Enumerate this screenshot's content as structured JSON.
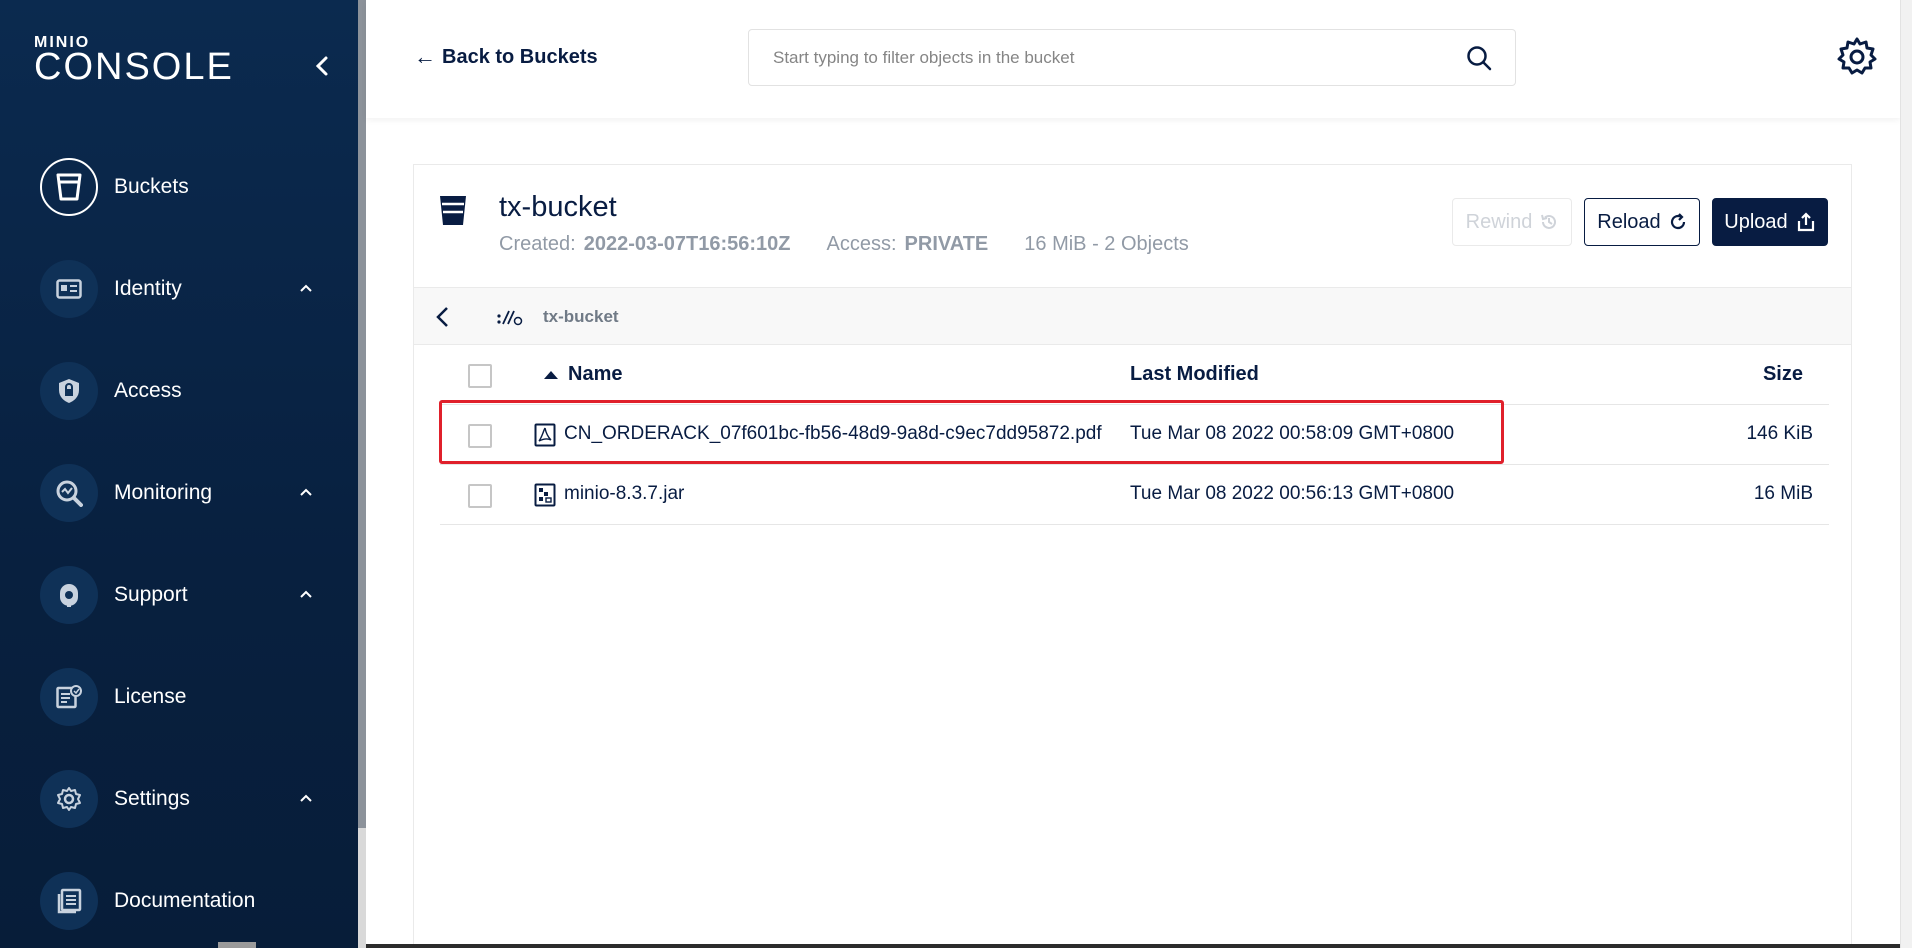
{
  "sidebar": {
    "logo_small": "MINIO",
    "logo_big": "CONSOLE",
    "items": [
      {
        "label": "Buckets",
        "icon": "bucket-icon",
        "active": true,
        "expandable": false
      },
      {
        "label": "Identity",
        "icon": "id-card-icon",
        "active": false,
        "expandable": true
      },
      {
        "label": "Access",
        "icon": "lock-shield-icon",
        "active": false,
        "expandable": false
      },
      {
        "label": "Monitoring",
        "icon": "monitoring-search-icon",
        "active": false,
        "expandable": true
      },
      {
        "label": "Support",
        "icon": "support-icon",
        "active": false,
        "expandable": true
      },
      {
        "label": "License",
        "icon": "license-icon",
        "active": false,
        "expandable": false
      },
      {
        "label": "Settings",
        "icon": "gear-icon",
        "active": false,
        "expandable": true
      },
      {
        "label": "Documentation",
        "icon": "documentation-icon",
        "active": false,
        "expandable": false
      }
    ]
  },
  "header": {
    "back_label": "Back to Buckets",
    "search_placeholder": "Start typing to filter objects in the bucket"
  },
  "bucket": {
    "name": "tx-bucket",
    "created_label": "Created:",
    "created_value": "2022-03-07T16:56:10Z",
    "access_label": "Access:",
    "access_value": "PRIVATE",
    "summary": "16 MiB - 2 Objects"
  },
  "toolbar": {
    "rewind_label": "Rewind",
    "reload_label": "Reload",
    "upload_label": "Upload"
  },
  "breadcrumb": {
    "current": "tx-bucket"
  },
  "table": {
    "columns": {
      "name": "Name",
      "last_modified": "Last Modified",
      "size": "Size"
    },
    "rows": [
      {
        "name": "CN_ORDERACK_07f601bc-fb56-48d9-9a8d-c9ec7dd95872.pdf",
        "last_modified": "Tue Mar 08 2022 00:58:09 GMT+0800",
        "size": "146 KiB",
        "icon": "pdf-file-icon",
        "highlighted": true
      },
      {
        "name": "minio-8.3.7.jar",
        "last_modified": "Tue Mar 08 2022 00:56:13 GMT+0800",
        "size": "16 MiB",
        "icon": "archive-file-icon",
        "highlighted": false
      }
    ]
  },
  "colors": {
    "sidebar_bg": "#0b2a4f",
    "primary": "#081c42",
    "muted": "#919aa6",
    "highlight": "#e0202b"
  }
}
